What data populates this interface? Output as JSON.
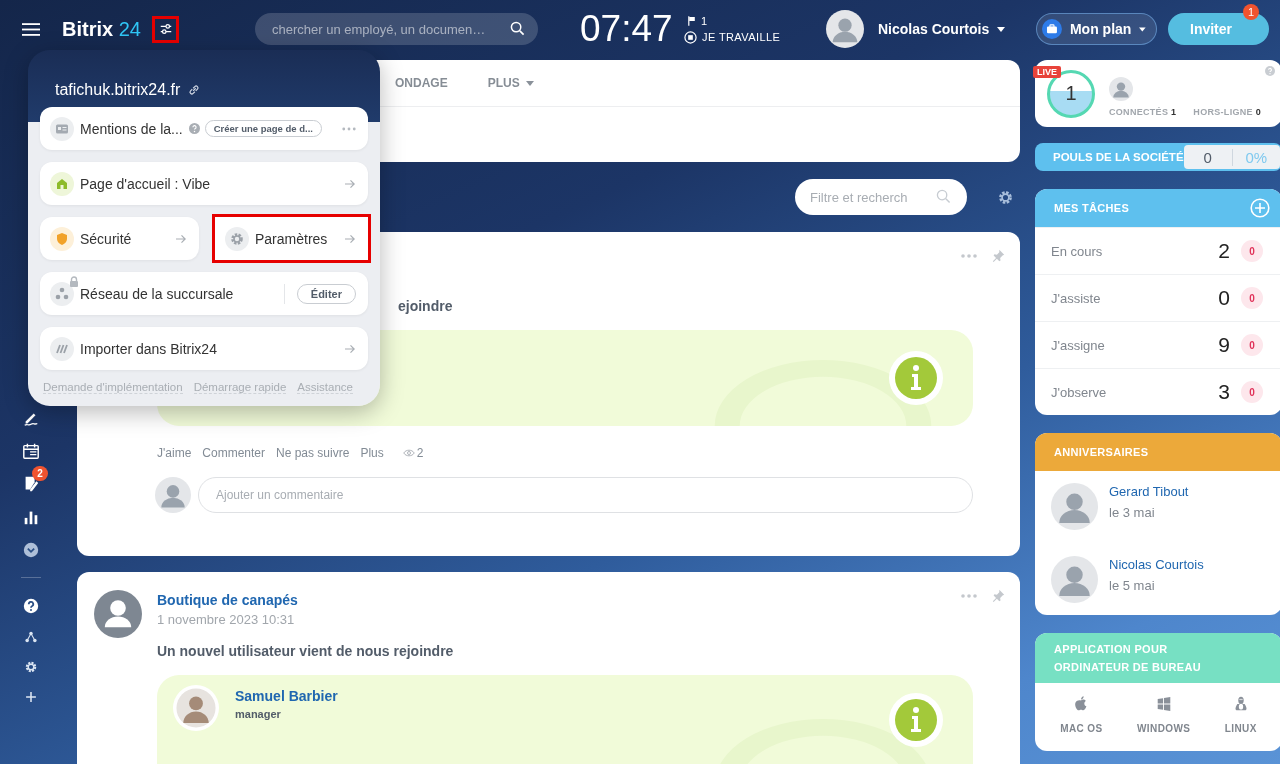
{
  "header": {
    "logo": {
      "name": "Bitrix",
      "number": "24"
    },
    "settings_highlighted": true,
    "search": {
      "placeholder": "chercher un employé, un documen…"
    },
    "clock": "07:47",
    "flag_count": "1",
    "work_status": "JE TRAVAILLE",
    "user": {
      "name": "Nicolas Courtois"
    },
    "plan_button": "Mon plan",
    "invite_button": {
      "label": "Inviter",
      "badge": "1"
    }
  },
  "sidebar": {
    "badge": "2"
  },
  "popup": {
    "portal": "tafichuk.bitrix24.fr",
    "items": [
      {
        "kind": "mentions",
        "label": "Mentions de la...",
        "chip": "Créer une page de d..."
      },
      {
        "kind": "link",
        "label": "Page d'accueil : Vibe",
        "highlighted": false
      },
      {
        "kind": "pair",
        "halves": [
          {
            "kind": "security",
            "label": "Sécurité",
            "highlighted": false
          },
          {
            "kind": "settings",
            "label": "Paramètres",
            "highlighted": true
          }
        ]
      },
      {
        "kind": "network",
        "label": "Réseau de la succursale",
        "button": "Éditer"
      },
      {
        "kind": "import",
        "label": "Importer dans Bitrix24",
        "highlighted": false
      }
    ],
    "footer_links": [
      "Demande d'implémentation",
      "Démarrage rapide",
      "Assistance"
    ]
  },
  "feed": {
    "tabs": [
      {
        "label": "ONDAGE",
        "dropdown": false
      },
      {
        "label": "PLUS",
        "dropdown": true
      }
    ],
    "filter": {
      "placeholder": "Filtre et recherch"
    },
    "posts": [
      {
        "title": "ejoindre",
        "actions": [
          "J'aime",
          "Commenter",
          "Ne pas suivre",
          "Plus"
        ],
        "views": "2",
        "comment_placeholder": "Ajouter un commentaire"
      },
      {
        "author": "Boutique de canapés",
        "date": "1 novembre 2023 10:31",
        "title": "Un nouvel utilisateur vient de nous rejoindre",
        "user": {
          "name": "Samuel Barbier",
          "role": "manager"
        }
      }
    ]
  },
  "right": {
    "online": {
      "live": "LIVE",
      "count": "1",
      "connected_label": "CONNECTÉS",
      "connected": "1",
      "offline_label": "HORS-LIGNE",
      "offline": "0"
    },
    "pulse": {
      "label": "POULS DE LA SOCIÉTÉ",
      "value": "0",
      "percent": "0%"
    },
    "tasks": {
      "title": "MES TÂCHES",
      "rows": [
        {
          "label": "En cours",
          "count": "2",
          "overdue": "0"
        },
        {
          "label": "J'assiste",
          "count": "0",
          "overdue": "0"
        },
        {
          "label": "J'assigne",
          "count": "9",
          "overdue": "0"
        },
        {
          "label": "J'observe",
          "count": "3",
          "overdue": "0"
        }
      ]
    },
    "birthdays": {
      "title": "ANNIVERSAIRES",
      "people": [
        {
          "name": "Gerard Tibout",
          "date": "le 3 mai"
        },
        {
          "name": "Nicolas Courtois",
          "date": "le 5 mai"
        }
      ]
    },
    "desktop": {
      "title": "APPLICATION POUR ORDINATEUR DE BUREAU",
      "platforms": [
        {
          "kind": "mac",
          "label": "MAC OS"
        },
        {
          "kind": "windows",
          "label": "WINDOWS"
        },
        {
          "kind": "linux",
          "label": "LINUX"
        }
      ]
    }
  }
}
